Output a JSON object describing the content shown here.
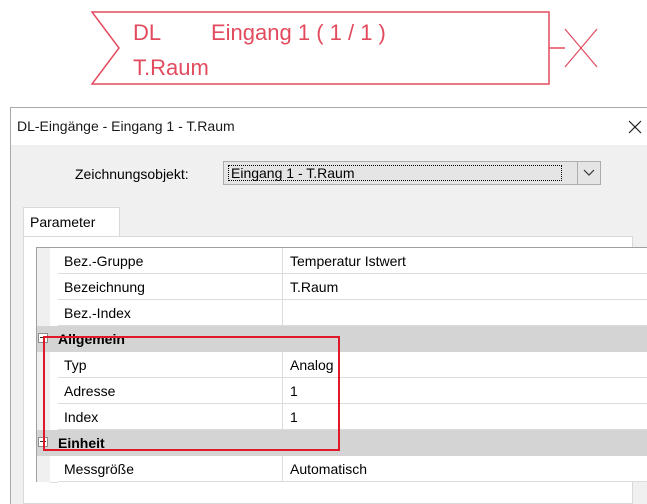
{
  "diagram": {
    "line1_left": "DL",
    "line1_right": "Eingang 1 ( 1 / 1 )",
    "line2": "T.Raum",
    "stroke_color": "#e24b5e"
  },
  "dialog": {
    "title": "DL-Eingänge - Eingang 1 - T.Raum",
    "close_icon": "close-icon"
  },
  "object_selector": {
    "label": "Zeichnungsobjekt:",
    "value": "Eingang 1 - T.Raum",
    "arrow_icon": "chevron-down-icon"
  },
  "tabs": [
    {
      "label": "Parameter",
      "selected": true
    }
  ],
  "grid": {
    "rows": [
      {
        "type": "property",
        "name": "Bez.-Gruppe",
        "value": "Temperatur Istwert"
      },
      {
        "type": "property",
        "name": "Bezeichnung",
        "value": "T.Raum"
      },
      {
        "type": "property",
        "name": "Bez.-Index",
        "value": ""
      },
      {
        "type": "category",
        "name": "Allgemein",
        "expanded": true
      },
      {
        "type": "property",
        "name": "Typ",
        "value": "Analog"
      },
      {
        "type": "property",
        "name": "Adresse",
        "value": "1"
      },
      {
        "type": "property",
        "name": "Index",
        "value": "1"
      },
      {
        "type": "category",
        "name": "Einheit",
        "expanded": true
      },
      {
        "type": "property",
        "name": "Messgröße",
        "value": "Automatisch"
      }
    ]
  },
  "highlight_color": "#e0192a"
}
